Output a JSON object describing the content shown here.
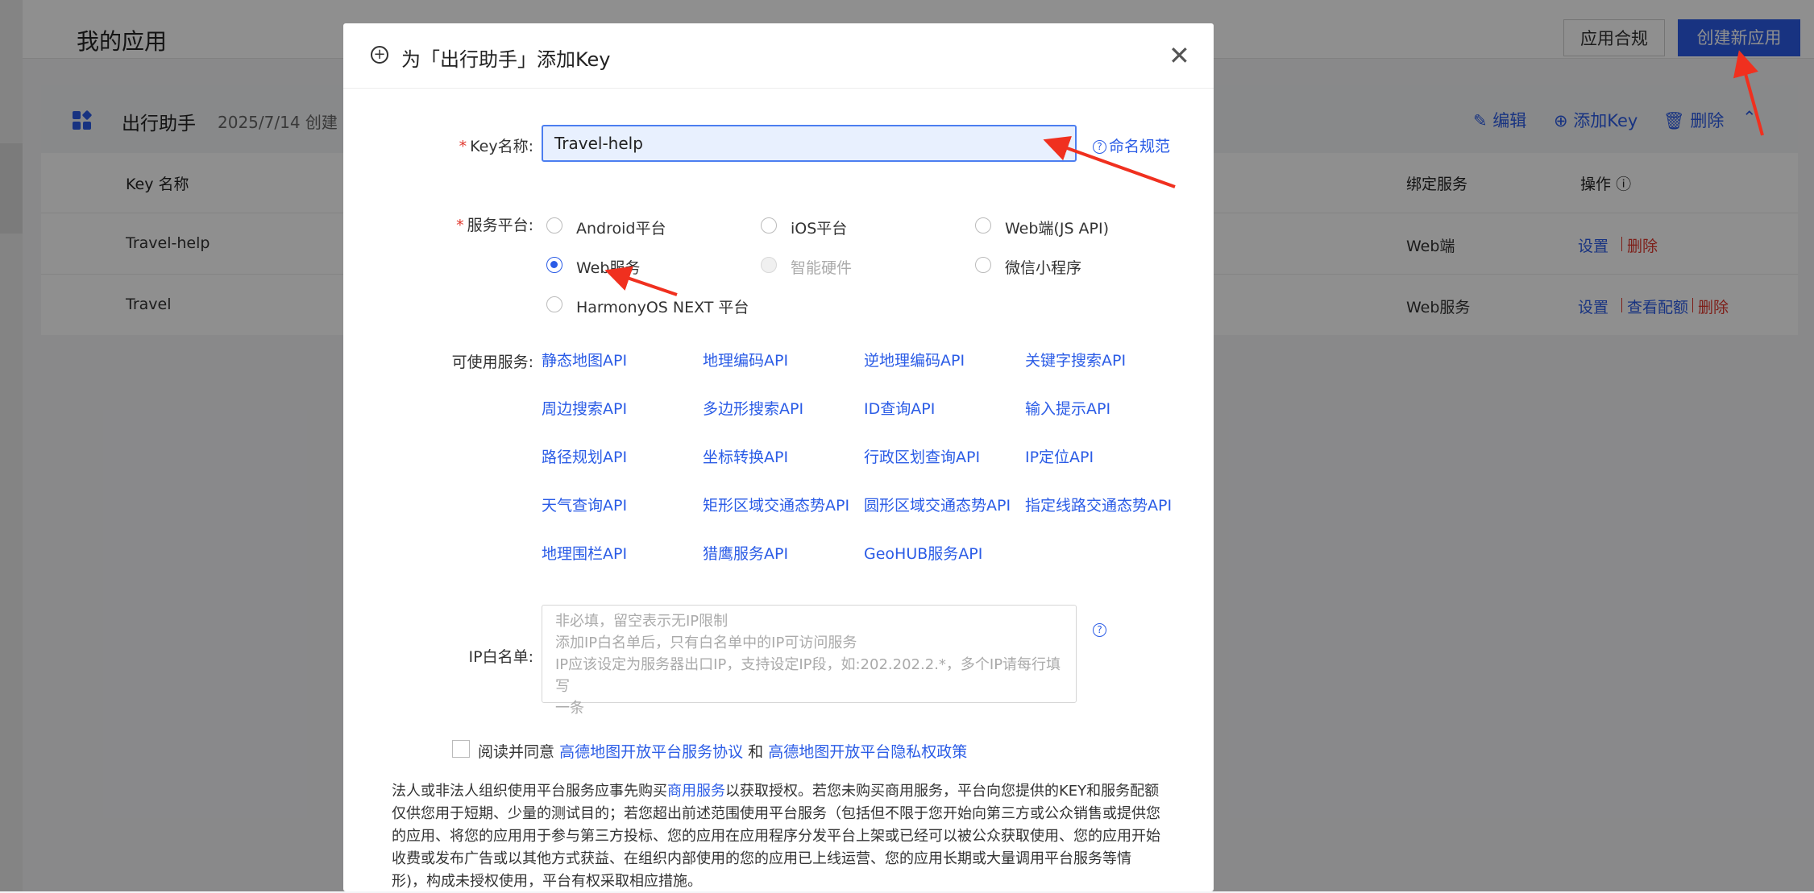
{
  "page": {
    "title": "我的应用",
    "compliance_button": "应用合规",
    "create_button": "创建新应用"
  },
  "app": {
    "name": "出行助手",
    "created": "2025/7/14 创建",
    "actions": {
      "edit": "编辑",
      "add_key": "添加Key",
      "delete": "删除"
    },
    "table": {
      "headers": {
        "key_name": "Key 名称",
        "bound_service": "绑定服务",
        "ops": "操作"
      },
      "rows": [
        {
          "key_name": "Travel-help",
          "service": "Web端",
          "set": "设置",
          "delete": "删除"
        },
        {
          "key_name": "Travel",
          "service": "Web服务",
          "set": "设置",
          "quota": "查看配额",
          "delete": "删除"
        }
      ]
    }
  },
  "modal": {
    "title": "为「出行助手」添加Key",
    "key_label": "Key名称:",
    "key_value": "Travel-help",
    "naming_rules": "命名规范",
    "platform_label": "服务平台:",
    "platforms": [
      {
        "label": "Android平台",
        "state": "unselected"
      },
      {
        "label": "iOS平台",
        "state": "unselected"
      },
      {
        "label": "Web端(JS API)",
        "state": "unselected"
      },
      {
        "label": "Web服务",
        "state": "selected"
      },
      {
        "label": "智能硬件",
        "state": "disabled"
      },
      {
        "label": "微信小程序",
        "state": "unselected"
      },
      {
        "label": "HarmonyOS NEXT 平台",
        "state": "unselected"
      }
    ],
    "services_label": "可使用服务:",
    "services": [
      "静态地图API",
      "地理编码API",
      "逆地理编码API",
      "关键字搜索API",
      "周边搜索API",
      "多边形搜索API",
      "ID查询API",
      "输入提示API",
      "路径规划API",
      "坐标转换API",
      "行政区划查询API",
      "IP定位API",
      "天气查询API",
      "矩形区域交通态势API",
      "圆形区域交通态势API",
      "指定线路交通态势API",
      "地理围栏API",
      "猎鹰服务API",
      "GeoHUB服务API"
    ],
    "ip_label": "IP白名单:",
    "ip_placeholder_lines": [
      "非必填，留空表示无IP限制",
      "添加IP白名单后，只有白名单中的IP可访问服务",
      "IP应该设定为服务器出口IP，支持设定IP段，如:202.202.2.*，多个IP请每行填写",
      "一条"
    ],
    "agree": {
      "prefix": "阅读并同意",
      "link1": "高德地图开放平台服务协议",
      "and": "和",
      "link2": "高德地图开放平台隐私权政策"
    },
    "legal": {
      "before": "法人或非法人组织使用平台服务应事先购买",
      "link": "商用服务",
      "after": "以获取授权。若您未购买商用服务，平台向您提供的KEY和服务配额仅供您用于短期、少量的测试目的；若您超出前述范围使用平台服务（包括但不限于您开始向第三方或公众销售或提供您的应用、将您的应用用于参与第三方投标、您的应用在应用程序分发平台上架或已经可以被公众获取使用、您的应用开始收费或发布广告或以其他方式获益、在组织内部使用的您的应用已上线运营、您的应用长期或大量调用平台服务等情形)，构成未授权使用，平台有权采取相应措施。"
    }
  },
  "colors": {
    "accent": "#2b5ce6",
    "danger": "#e0362c",
    "annotation": "#f0301f"
  }
}
